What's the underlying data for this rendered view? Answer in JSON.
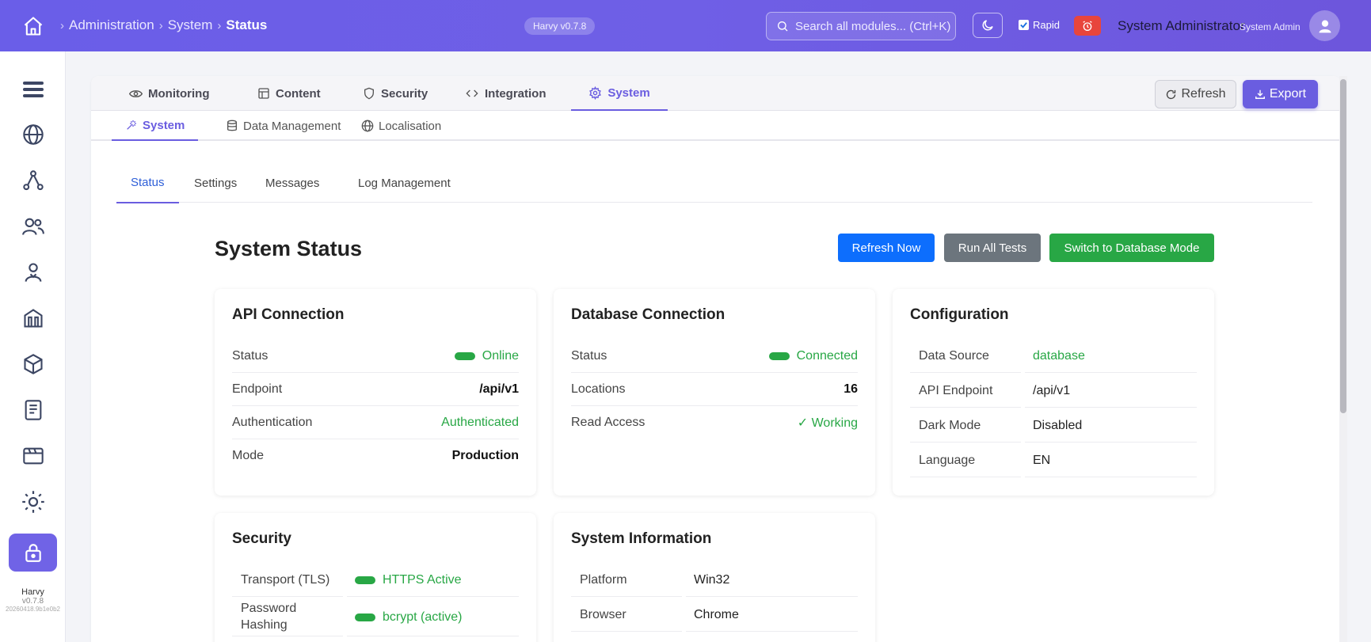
{
  "header": {
    "breadcrumbs": [
      "Administration",
      "System",
      "Status"
    ],
    "version_badge": "Harvy v0.7.8",
    "search_placeholder": "Search all modules... (Ctrl+K)",
    "rapid_label": "Rapid",
    "rapid_checked": true,
    "user_name": "System Administrator",
    "user_role": "System Admin"
  },
  "sidebar": {
    "items": [
      "menu-icon",
      "globe-icon",
      "network-icon",
      "users-icon",
      "user-icon",
      "building-icon",
      "cube-icon",
      "document-icon",
      "panel-icon",
      "sun-icon",
      "lock-icon"
    ],
    "active_index": 10,
    "footer": {
      "app_name": "Harvy",
      "version": "v0.7.8",
      "build": "20260418.9b1e0b2"
    }
  },
  "toolbar": {
    "refresh_label": "Refresh",
    "export_label": "Export"
  },
  "main_tabs": [
    {
      "label": "Monitoring",
      "icon": "eye-icon"
    },
    {
      "label": "Content",
      "icon": "layout-icon"
    },
    {
      "label": "Security",
      "icon": "shield-icon"
    },
    {
      "label": "Integration",
      "icon": "code-icon"
    },
    {
      "label": "System",
      "icon": "gear-icon",
      "active": true
    }
  ],
  "sub_tabs": [
    {
      "label": "System",
      "icon": "magic-icon",
      "active": true
    },
    {
      "label": "Data Management",
      "icon": "database-icon"
    },
    {
      "label": "Localisation",
      "icon": "globe-icon"
    }
  ],
  "inner_tabs": [
    "Status",
    "Settings",
    "Messages",
    "Log Management"
  ],
  "status": {
    "title": "System Status",
    "buttons": {
      "refresh_now": "Refresh Now",
      "run_all_tests": "Run All Tests",
      "switch_mode": "Switch to Database Mode"
    }
  },
  "cards": {
    "api": {
      "title": "API Connection",
      "rows": [
        {
          "k": "Status",
          "v": "Online"
        },
        {
          "k": "Endpoint",
          "v": "/api/v1"
        },
        {
          "k": "Authentication",
          "v": "Authenticated"
        },
        {
          "k": "Mode",
          "v": "Production"
        }
      ]
    },
    "database": {
      "title": "Database Connection",
      "rows": [
        {
          "k": "Status",
          "v": "Connected"
        },
        {
          "k": "Locations",
          "v": "16"
        },
        {
          "k": "Read Access",
          "v": "✓ Working"
        }
      ]
    },
    "configuration": {
      "title": "Configuration",
      "rows": [
        {
          "k": "Data Source",
          "v": "database"
        },
        {
          "k": "API Endpoint",
          "v": "/api/v1"
        },
        {
          "k": "Dark Mode",
          "v": "Disabled"
        },
        {
          "k": "Language",
          "v": "EN"
        }
      ]
    },
    "security": {
      "title": "Security",
      "rows": [
        {
          "k": "Transport (TLS)",
          "v": "HTTPS Active"
        },
        {
          "k": "Password Hashing",
          "v": "bcrypt (active)"
        }
      ]
    },
    "sysinfo": {
      "title": "System Information",
      "rows": [
        {
          "k": "Platform",
          "v": "Win32"
        },
        {
          "k": "Browser",
          "v": "Chrome"
        }
      ]
    }
  },
  "colors": {
    "accent": "#6a5de0",
    "success": "#28a745",
    "primary": "#0d6efd",
    "secondary": "#6c757d"
  }
}
